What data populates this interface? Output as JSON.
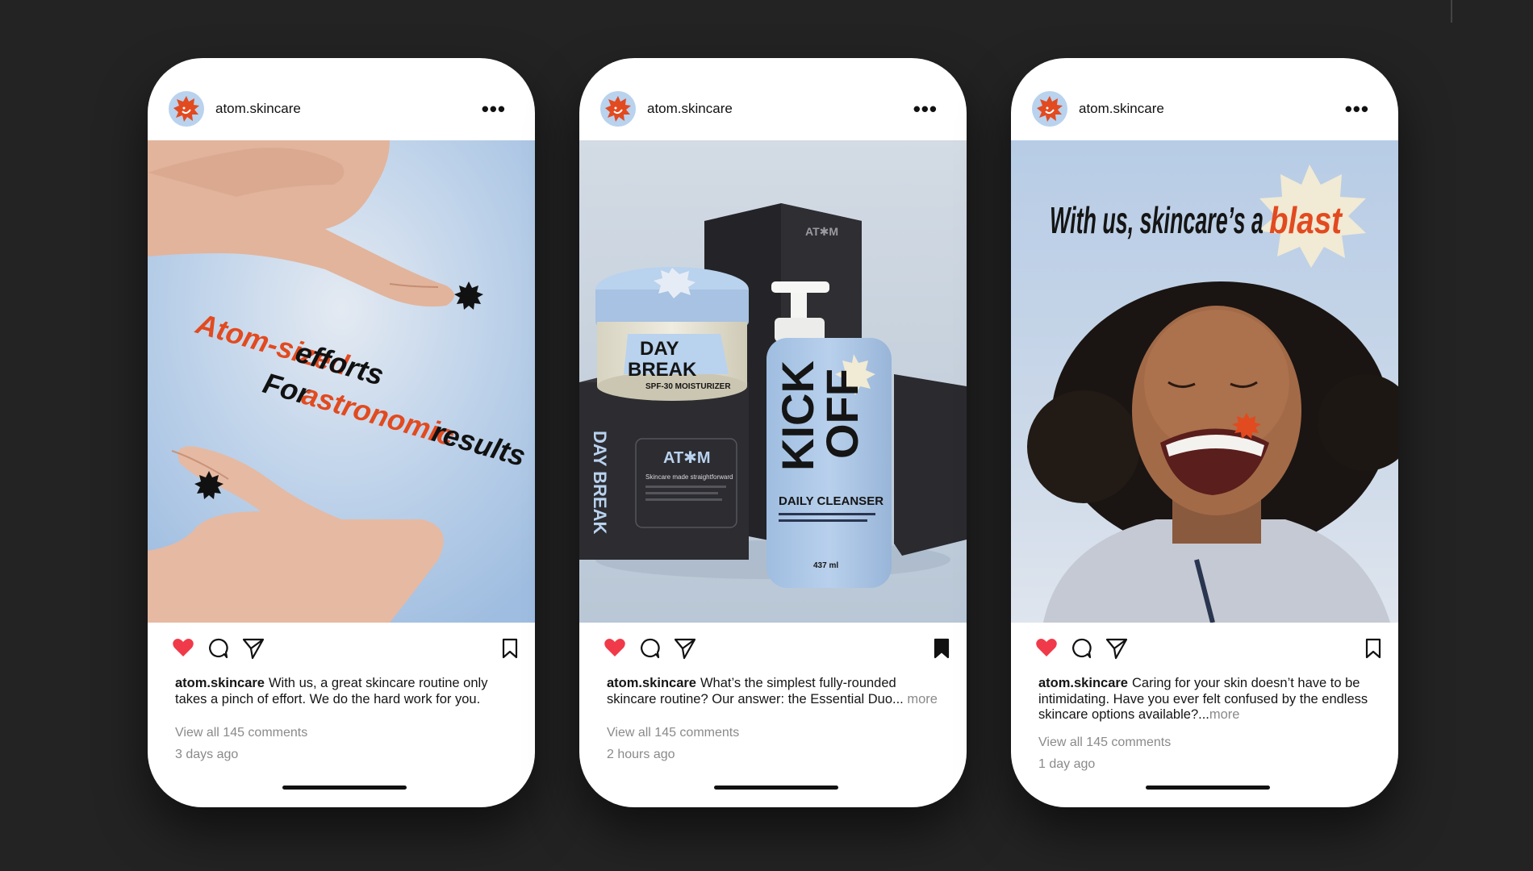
{
  "account": {
    "username": "atom.skincare"
  },
  "colors": {
    "background": "#232323",
    "accent_orange": "#e24a1f",
    "sky_blue": "#b9d2ee",
    "like_red": "#f03a4a",
    "cream": "#f1ead4"
  },
  "posts": [
    {
      "username": "atom.skincare",
      "overlay": {
        "line1_highlight": "Atom-sized",
        "line1_rest": " efforts",
        "line2_start": "For ",
        "line2_highlight": "astronomic",
        "line2_rest": " results"
      },
      "liked": true,
      "saved": false,
      "caption_user": "atom.skincare",
      "caption_text": "With us, a great skincare routine only takes a pinch of effort. We do the hard work for you.",
      "caption_more": "",
      "view_comments": "View all 145 comments",
      "time_ago": "3 days ago"
    },
    {
      "username": "atom.skincare",
      "product": {
        "jar_line1": "DAY",
        "jar_line2": "BREAK",
        "jar_sub": "SPF-30 MOISTURIZER",
        "box_brand": "AT✱M",
        "box_tagline": "Skincare made straightforward",
        "bottle_line1": "KICK",
        "bottle_line2": "OFF",
        "bottle_name": "DAILY CLEANSER",
        "bottle_volume": "437 ml"
      },
      "liked": true,
      "saved": true,
      "caption_user": "atom.skincare",
      "caption_text": "What’s the simplest fully-rounded skincare routine? Our answer: the Essential Duo...",
      "caption_more": " more",
      "view_comments": "View all 145 comments",
      "time_ago": "2 hours ago"
    },
    {
      "username": "atom.skincare",
      "overlay": {
        "headline": "With us, skincare’s a",
        "highlight": "blast"
      },
      "liked": true,
      "saved": false,
      "caption_user": "atom.skincare",
      "caption_text": "Caring for your skin doesn’t have to be intimidating. Have you ever felt confused by the endless skincare options available?...",
      "caption_more": "more",
      "view_comments": "View all 145 comments",
      "time_ago": "1 day ago"
    }
  ]
}
